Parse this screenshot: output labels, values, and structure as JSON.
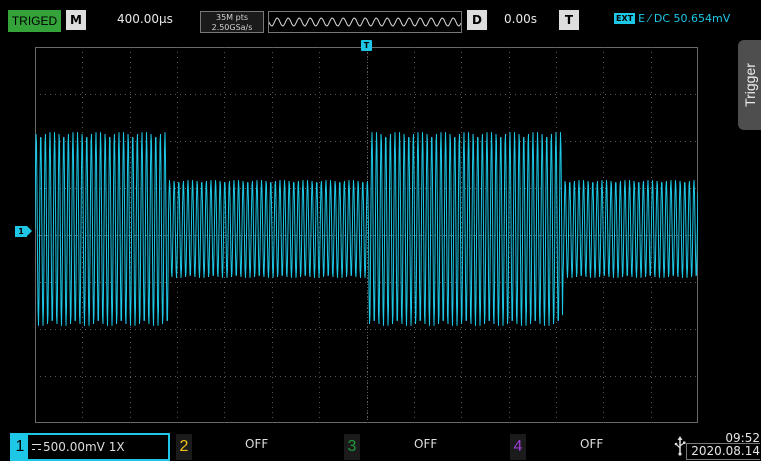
{
  "status": {
    "trigger_state": "TRIGED",
    "menu_btn": "M",
    "timebase": "400.00µs",
    "mem_depth": "35M pts",
    "sample_rate": "2.50GSa/s",
    "delay_btn": "D",
    "delay": "0.00s",
    "trigger_btn": "T",
    "trigger_source": "EXT",
    "trigger_desc": "E ⁄ DC 50.654mV"
  },
  "screen": {
    "trigger_marker": "T",
    "ch1_marker": "1",
    "side_tab": "Trigger",
    "trace_color": "#1dc7e5",
    "grid_color": "#5a5a5a"
  },
  "channels": [
    {
      "num": "1",
      "label": "500.00mV 1X",
      "color": "#1dc7e5",
      "active": true
    },
    {
      "num": "2",
      "label": "OFF",
      "color": "#f2c21a",
      "active": false
    },
    {
      "num": "3",
      "label": "OFF",
      "color": "#1f9a3a",
      "active": false
    },
    {
      "num": "4",
      "label": "OFF",
      "color": "#9a3fd6",
      "active": false
    }
  ],
  "clock": {
    "time": "09:52",
    "date": "2020.08.14"
  }
}
